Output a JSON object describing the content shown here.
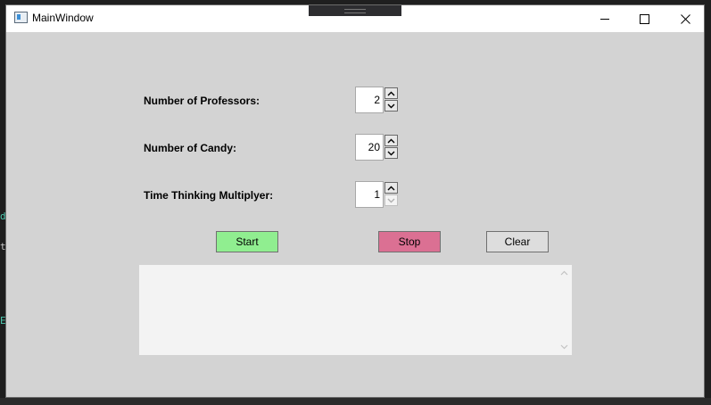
{
  "window": {
    "title": "MainWindow"
  },
  "background": {
    "glyphs": [
      "d",
      "t",
      "E"
    ]
  },
  "form": {
    "professors_label": "Number of Professors:",
    "professors_value": "2",
    "candy_label": "Number of Candy:",
    "candy_value": "20",
    "multiplier_label": "Time Thinking Multiplyer:",
    "multiplier_value": "1"
  },
  "buttons": {
    "start": "Start",
    "stop": "Stop",
    "clear": "Clear"
  },
  "output": {
    "text": ""
  },
  "colors": {
    "window_bg": "#d3d3d3",
    "start_bg": "#90ee90",
    "stop_bg": "#db7093",
    "clear_bg": "#dddddd"
  },
  "icons": {
    "app": "window-app-icon",
    "minimize": "minimize-icon",
    "maximize": "maximize-icon",
    "close": "close-icon",
    "spin_up": "chevron-up-icon",
    "spin_down": "chevron-down-icon"
  }
}
